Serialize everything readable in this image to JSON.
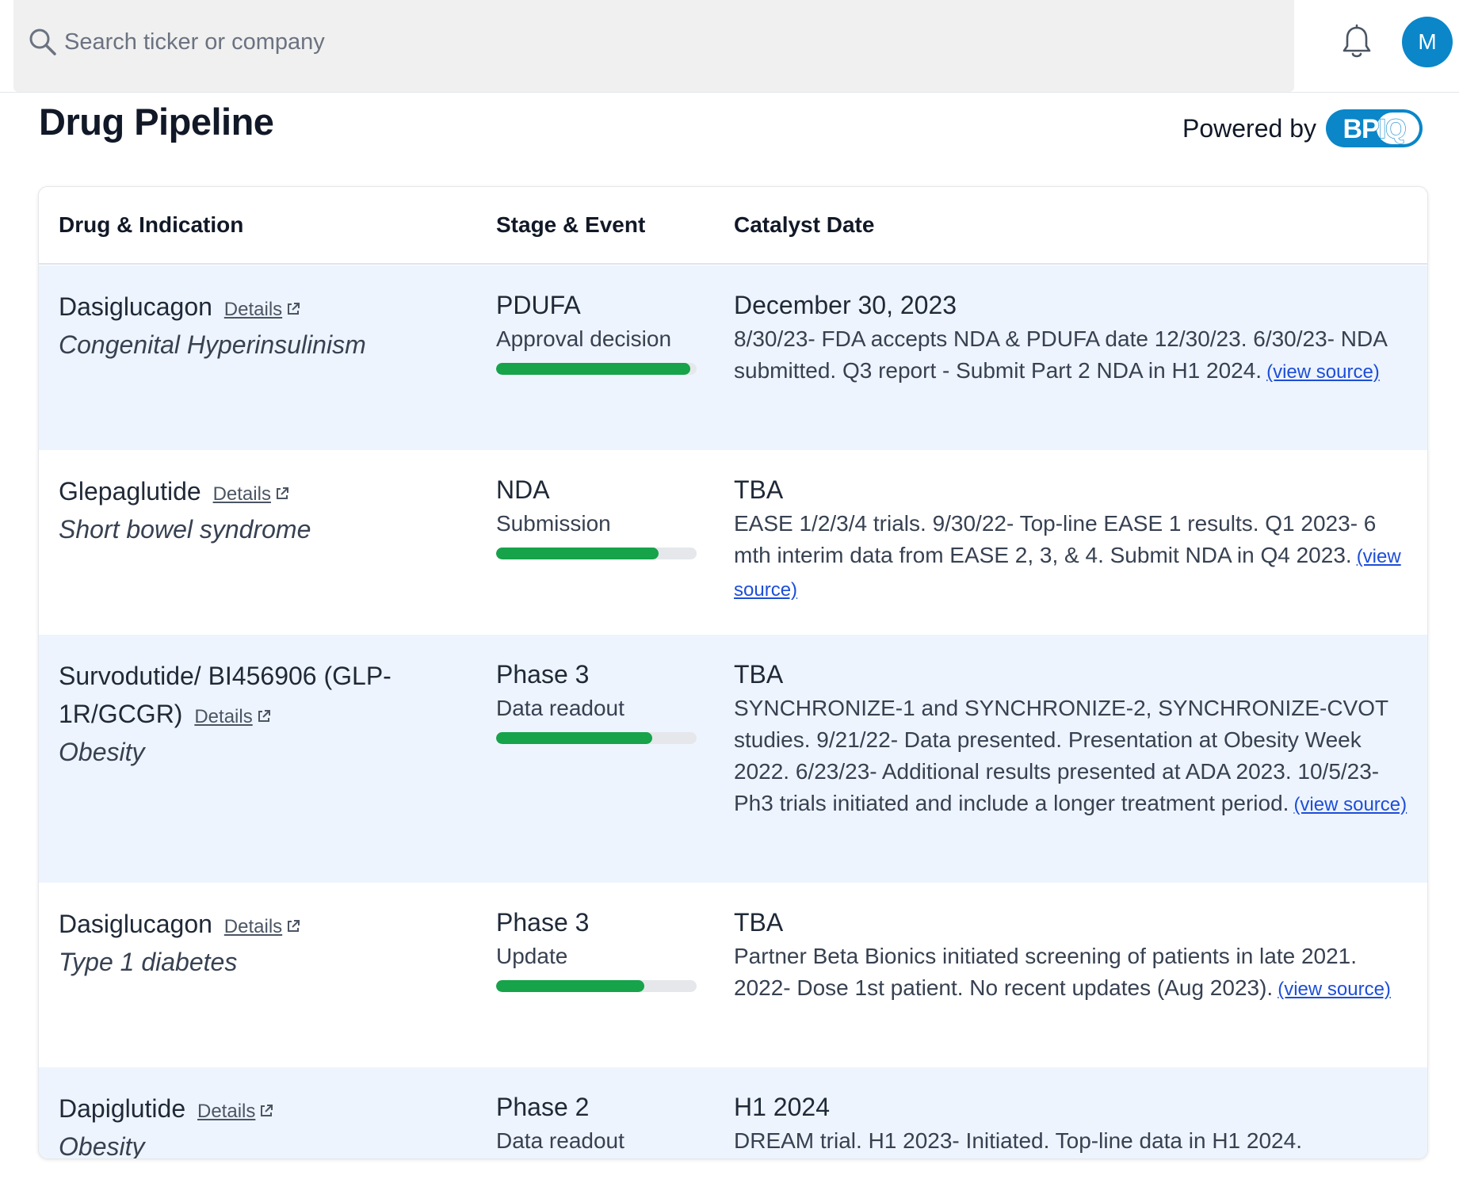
{
  "search": {
    "placeholder": "Search ticker or company"
  },
  "user": {
    "avatar_initial": "M"
  },
  "page": {
    "title": "Drug Pipeline",
    "powered_by": "Powered by",
    "logo_text": "BPIQ"
  },
  "table": {
    "headers": [
      "Drug & Indication",
      "Stage & Event",
      "Catalyst Date"
    ],
    "details_label": "Details",
    "source_label": "(view source)",
    "rows": [
      {
        "drug": "Dasiglucagon",
        "indication": "Congenital Hyperinsulinism",
        "stage": "PDUFA",
        "event": "Approval decision",
        "progress": 0.97,
        "date": "December 30, 2023",
        "description": "8/30/23- FDA accepts NDA & PDUFA date 12/30/23. 6/30/23- NDA submitted. Q3 report - Submit Part 2 NDA in H1 2024."
      },
      {
        "drug": "Glepaglutide",
        "indication": "Short bowel syndrome",
        "stage": "NDA",
        "event": "Submission",
        "progress": 0.81,
        "date": "TBA",
        "description": "EASE 1/2/3/4 trials. 9/30/22- Top-line EASE 1 results. Q1 2023- 6 mth interim data from EASE 2, 3, & 4. Submit NDA in Q4 2023."
      },
      {
        "drug": "Survodutide/ BI456906 (GLP-1R/GCGR)",
        "indication": "Obesity",
        "stage": "Phase 3",
        "event": "Data readout",
        "progress": 0.78,
        "date": "TBA",
        "description": "SYNCHRONIZE-1 and SYNCHRONIZE-2, SYNCHRONIZE-CVOT studies. 9/21/22- Data presented. Presentation at Obesity Week 2022. 6/23/23- Additional results presented at ADA 2023. 10/5/23- Ph3 trials initiated and include a longer treatment period."
      },
      {
        "drug": "Dasiglucagon",
        "indication": "Type 1 diabetes",
        "stage": "Phase 3",
        "event": "Update",
        "progress": 0.74,
        "date": "TBA",
        "description": "Partner Beta Bionics initiated screening of patients in late 2021. 2022- Dose 1st patient. No recent updates (Aug 2023)."
      },
      {
        "drug": "Dapiglutide",
        "indication": "Obesity",
        "stage": "Phase 2",
        "event": "Data readout",
        "date": "H1 2024",
        "description": "DREAM trial. H1 2023- Initiated. Top-line data in H1 2024."
      }
    ]
  },
  "colors": {
    "accent": "#0a86c9",
    "progress": "#16a34a",
    "row_shade": "#eef4fd",
    "link": "#1d4ed8"
  }
}
